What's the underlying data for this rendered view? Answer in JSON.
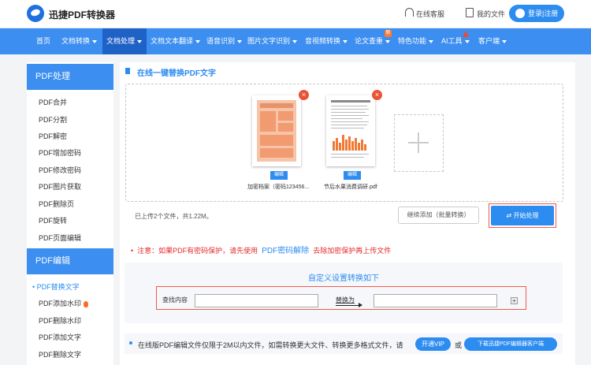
{
  "header": {
    "brand": "迅捷PDF转换器",
    "customer_service": "在线客服",
    "my_files": "我的文件",
    "login": "登录|注册"
  },
  "nav": {
    "items": [
      {
        "label": "首页",
        "dropdown": false
      },
      {
        "label": "文档转换",
        "dropdown": true
      },
      {
        "label": "文档处理",
        "dropdown": true,
        "active": true
      },
      {
        "label": "文档文本翻译",
        "dropdown": true
      },
      {
        "label": "语音识别",
        "dropdown": true
      },
      {
        "label": "图片文字识别",
        "dropdown": true
      },
      {
        "label": "音视频转换",
        "dropdown": true
      },
      {
        "label": "论文查重",
        "dropdown": true,
        "badge": "新"
      },
      {
        "label": "特色功能",
        "dropdown": true
      },
      {
        "label": "AI工具",
        "dropdown": true
      },
      {
        "label": "客户端",
        "dropdown": true
      }
    ]
  },
  "sidebar": {
    "section1_title": "PDF处理",
    "section1_items": [
      "PDF合并",
      "PDF分割",
      "PDF解密",
      "PDF增加密码",
      "PDF修改密码",
      "PDF图片获取",
      "PDF删除页",
      "PDF旋转",
      "PDF页面编辑"
    ],
    "section2_title": "PDF编辑",
    "section2_items": [
      "PDF替换文字",
      "PDF添加水印",
      "PDF删除水印",
      "PDF添加文字",
      "PDF删除文字"
    ],
    "active_item": "PDF替换文字"
  },
  "main": {
    "title": "在线一键替换PDF文字",
    "files": [
      {
        "name": "加密档案（密码123456...",
        "edit_label": "编辑"
      },
      {
        "name": "节后水果消费调研.pdf",
        "edit_label": "编辑"
      }
    ],
    "uploaded_summary": "已上传2个文件，共1.22M。",
    "continue_add": "继续添加（批量转换）",
    "start": "开始处理",
    "notice_prefix": "注意：如果PDF有密码保护，请先使用",
    "notice_link": "PDF密码解除",
    "notice_suffix": "去除加密保护再上传文件",
    "config_title": "自定义设置转换如下",
    "find_label": "查找内容",
    "find_value": "",
    "replace_label": "替换为",
    "replace_value": "",
    "footer_text": "在线版PDF编辑文件仅限于2M以内文件，如需转换更大文件、转换更多格式文件，请",
    "vip_button": "开通VIP",
    "or_label": "或",
    "download_button": "下载迅捷PDF编辑器客户端"
  },
  "colors": {
    "primary": "#3c8ef0",
    "nav_active": "#1f62c6",
    "warning": "#e52a2a",
    "highlight_border": "#f15b4a"
  }
}
